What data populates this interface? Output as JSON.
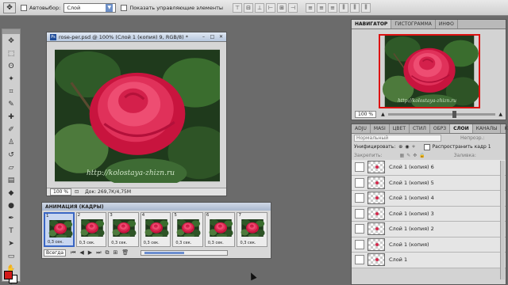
{
  "options_bar": {
    "autoselect_label": "Автовыбор:",
    "autoselect_value": "Слой",
    "show_controls_label": "Показать управляющие элементы"
  },
  "document": {
    "title": "rose-per.psd @ 100% (Слой 1 (копия) 9, RGB/8) *",
    "zoom": "100 %",
    "doc_size": "Док: 269,7К/4,75M",
    "watermark": "http://kolostaya-zhizn.ru"
  },
  "animation": {
    "title": "АНИМАЦИЯ (КАДРЫ)",
    "frames": [
      {
        "num": "1",
        "delay": "0,3 сек."
      },
      {
        "num": "2",
        "delay": "0,3 сек."
      },
      {
        "num": "3",
        "delay": "0,3 сек."
      },
      {
        "num": "4",
        "delay": "0,3 сек."
      },
      {
        "num": "5",
        "delay": "0,3 сек."
      },
      {
        "num": "6",
        "delay": "0,3 сек."
      },
      {
        "num": "7",
        "delay": "0,3 сек."
      }
    ],
    "loop": "Всегда"
  },
  "navigator": {
    "tabs": [
      "НАВИГАТОР",
      "ГИСТОГРАММА",
      "ИНФО"
    ],
    "zoom": "100 %",
    "watermark": "http://kolostaya-zhizn.ru"
  },
  "layers": {
    "tabs": [
      "ADJU",
      "MASI",
      "ЦВЕТ",
      "СТИЛ",
      "ОБРЗ",
      "СЛОИ",
      "КАНАЛЫ",
      "КОНТ"
    ],
    "blend_mode": "Нормальный",
    "opacity_label": "Непрозр.:",
    "unify_label": "Унифицировать:",
    "propagate_label": "Распространить кадр 1",
    "lock_label": "Закрепить:",
    "fill_label": "Заливка:",
    "items": [
      "Слой 1 (копия) 6",
      "Слой 1 (копия) 5",
      "Слой 1 (копия) 4",
      "Слой 1 (копия) 3",
      "Слой 1 (копия) 2",
      "Слой 1 (копия)",
      "Слой 1"
    ]
  },
  "colors": {
    "foreground": "#d21a1a",
    "background": "#ffffff",
    "rose": "#e0315a"
  }
}
